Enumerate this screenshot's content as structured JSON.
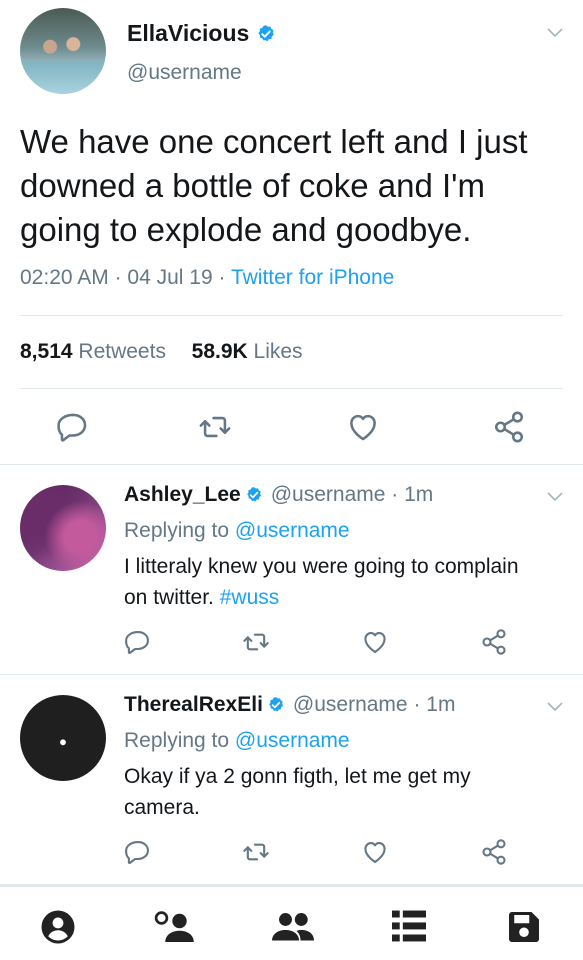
{
  "main_tweet": {
    "display_name": "EllaVicious",
    "handle": "@username",
    "text": "We have one concert left and I just downed a bottle of coke and I'm going to explode and goodbye.",
    "time": "02:20 AM",
    "date": "04 Jul 19",
    "client": "Twitter for iPhone",
    "retweets_count": "8,514",
    "retweets_label": "Retweets",
    "likes_count": "58.9K",
    "likes_label": "Likes"
  },
  "replies": [
    {
      "display_name": "Ashley_Lee",
      "handle_time": "@username · 1m",
      "replying_prefix": "Replying to",
      "replying_to": "@username",
      "text": "I litteraly knew you were going to complain on twitter.",
      "hashtag": "#wuss"
    },
    {
      "display_name": "TherealRexEli",
      "handle_time": "@username · 1m",
      "replying_prefix": "Replying to",
      "replying_to": "@username",
      "text": "Okay if ya 2 gonn figth, let me get my camera."
    }
  ],
  "icons": {
    "reply": "reply-icon",
    "retweet": "retweet-icon",
    "like": "heart-icon",
    "share": "share-icon",
    "verified": "verified-badge-icon",
    "menu": "chevron-down-icon",
    "nav": [
      "profile-icon",
      "follow-icon",
      "people-icon",
      "list-icon",
      "save-icon"
    ]
  },
  "colors": {
    "accent": "#1da1f2",
    "text": "#14171a",
    "secondary": "#657786",
    "divider": "#e1e8ed",
    "icon": "#657786"
  }
}
